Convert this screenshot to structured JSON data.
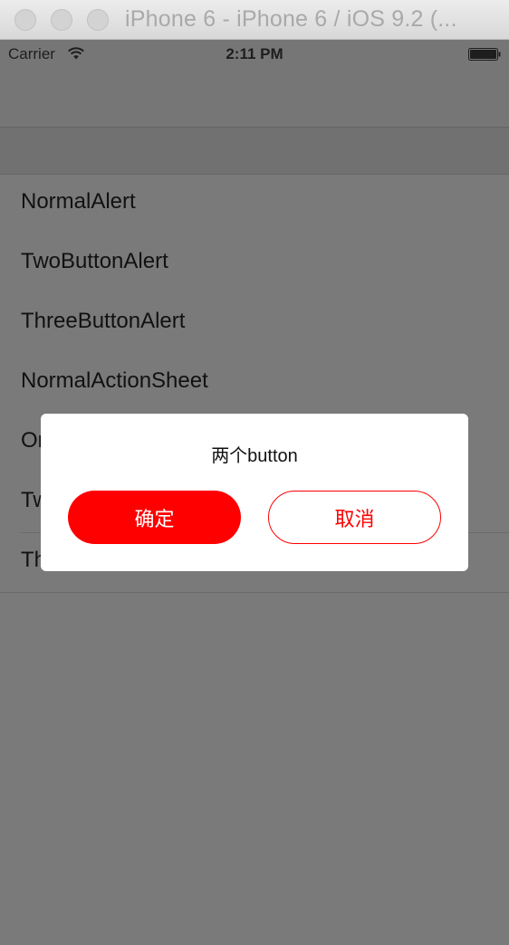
{
  "window": {
    "title": "iPhone 6 - iPhone 6 / iOS 9.2 (..."
  },
  "statusbar": {
    "carrier": "Carrier",
    "time": "2:11 PM",
    "wifi_icon": "wifi-icon",
    "battery_icon": "battery-icon"
  },
  "list": {
    "items": [
      {
        "label": "NormalAlert"
      },
      {
        "label": "TwoButtonAlert"
      },
      {
        "label": "ThreeButtonAlert"
      },
      {
        "label": "NormalActionSheet"
      },
      {
        "label": "On"
      },
      {
        "label": "Tw"
      },
      {
        "label": "Th"
      }
    ]
  },
  "alert": {
    "message": "两个button",
    "confirm_label": "确定",
    "cancel_label": "取消"
  },
  "colors": {
    "accent": "#ff0000",
    "dim_background": "#7a7a7b"
  }
}
